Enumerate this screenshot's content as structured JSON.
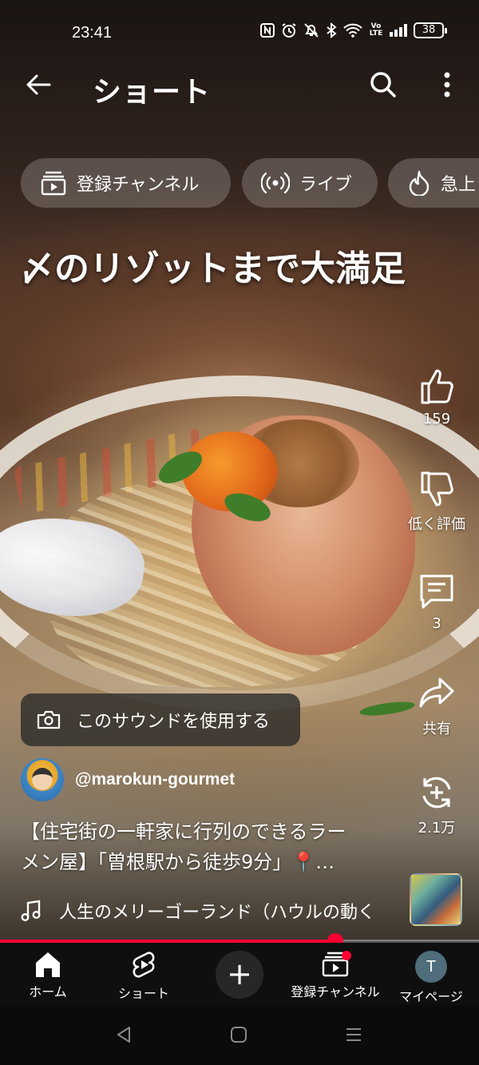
{
  "status_bar": {
    "time": "23:41",
    "battery": "38",
    "volte": "Vo LTE",
    "icons": [
      "nfc-icon",
      "alarm-icon",
      "mute-icon",
      "bluetooth-icon",
      "wifi-icon",
      "volte-icon",
      "signal-icon",
      "battery-icon"
    ]
  },
  "header": {
    "title": "ショート"
  },
  "chips": [
    {
      "label": "登録チャンネル",
      "icon": "subscriptions-icon"
    },
    {
      "label": "ライブ",
      "icon": "live-icon"
    },
    {
      "label": "急上",
      "icon": "trending-icon"
    }
  ],
  "video": {
    "overlay_text": "〆のリゾットまで大満足",
    "progress": 0.7
  },
  "actions": {
    "like_count": "159",
    "dislike_label": "低く評価",
    "comment_count": "3",
    "share_label": "共有",
    "remix_count": "2.1万"
  },
  "sound_chip": {
    "label": "このサウンドを使用する"
  },
  "channel": {
    "handle": "@marokun-gourmet"
  },
  "description": {
    "line1": "【住宅街の一軒家に行列のできるラー",
    "line2": "メン屋】「曽根駅から徒歩9分」📍…"
  },
  "music": {
    "title": "人生のメリーゴーランド（ハウルの動く"
  },
  "bottom_nav": {
    "home": "ホーム",
    "shorts": "ショート",
    "subscriptions": "登録チャンネル",
    "you": "マイページ",
    "avatar_letter": "T"
  },
  "colors": {
    "accent": "#ff0033",
    "nav_bg": "#0f0f0f"
  }
}
